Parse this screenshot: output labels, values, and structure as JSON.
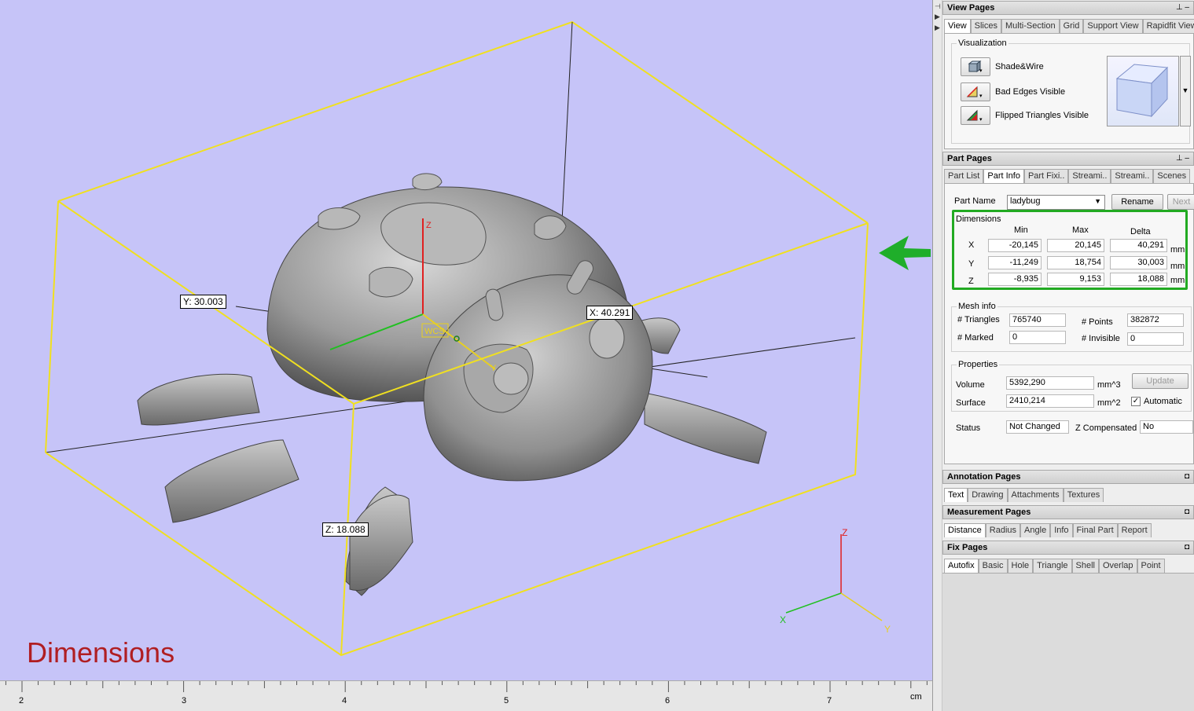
{
  "viewport": {
    "title": "Dimensions",
    "labels": {
      "x": "X: 40.291",
      "y": "Y: 30.003",
      "z": "Z: 18.088"
    },
    "wcs": "WCS",
    "axes": {
      "x": "X",
      "y": "Y",
      "z": "Z"
    },
    "ruler": {
      "ticks": [
        "2",
        "3",
        "4",
        "5",
        "6",
        "7"
      ],
      "unit": "cm"
    }
  },
  "view_pages": {
    "title": "View Pages",
    "tabs": [
      "View",
      "Slices",
      "Multi-Section",
      "Grid",
      "Support View",
      "Rapidfit View"
    ],
    "visualization_title": "Visualization",
    "items": [
      "Shade&Wire",
      "Bad Edges Visible",
      "Flipped Triangles Visible"
    ]
  },
  "part_pages": {
    "title": "Part Pages",
    "tabs": [
      "Part List",
      "Part Info",
      "Part Fixi..",
      "Streami..",
      "Streami..",
      "Scenes"
    ],
    "part_name_label": "Part Name",
    "part_name": "ladybug",
    "rename": "Rename",
    "next": "Next",
    "dimensions": {
      "title": "Dimensions",
      "headers": [
        "Min",
        "Max",
        "Delta"
      ],
      "unit": "mm",
      "rows": [
        {
          "axis": "X",
          "min": "-20,145",
          "max": "20,145",
          "delta": "40,291"
        },
        {
          "axis": "Y",
          "min": "-11,249",
          "max": "18,754",
          "delta": "30,003"
        },
        {
          "axis": "Z",
          "min": "-8,935",
          "max": "9,153",
          "delta": "18,088"
        }
      ]
    },
    "mesh_info": {
      "title": "Mesh info",
      "triangles_label": "# Triangles",
      "triangles": "765740",
      "points_label": "# Points",
      "points": "382872",
      "marked_label": "# Marked",
      "marked": "0",
      "invisible_label": "# Invisible",
      "invisible": "0"
    },
    "properties": {
      "title": "Properties",
      "volume_label": "Volume",
      "volume": "5392,290",
      "volume_unit": "mm^3",
      "surface_label": "Surface",
      "surface": "2410,214",
      "surface_unit": "mm^2",
      "update": "Update",
      "automatic": "Automatic"
    },
    "status_label": "Status",
    "status": "Not Changed",
    "zcomp_label": "Z Compensated",
    "zcomp": "No"
  },
  "annotation_pages": {
    "title": "Annotation Pages",
    "tabs": [
      "Text",
      "Drawing",
      "Attachments",
      "Textures"
    ]
  },
  "measurement_pages": {
    "title": "Measurement Pages",
    "tabs": [
      "Distance",
      "Radius",
      "Angle",
      "Info",
      "Final Part",
      "Report"
    ]
  },
  "fix_pages": {
    "title": "Fix Pages",
    "tabs": [
      "Autofix",
      "Basic",
      "Hole",
      "Triangle",
      "Shell",
      "Overlap",
      "Point"
    ]
  },
  "colors": {
    "viewport_bg": "#c6c4f8",
    "bbox": "#f0e020",
    "highlight": "#22aa22",
    "title": "#b01e22"
  }
}
